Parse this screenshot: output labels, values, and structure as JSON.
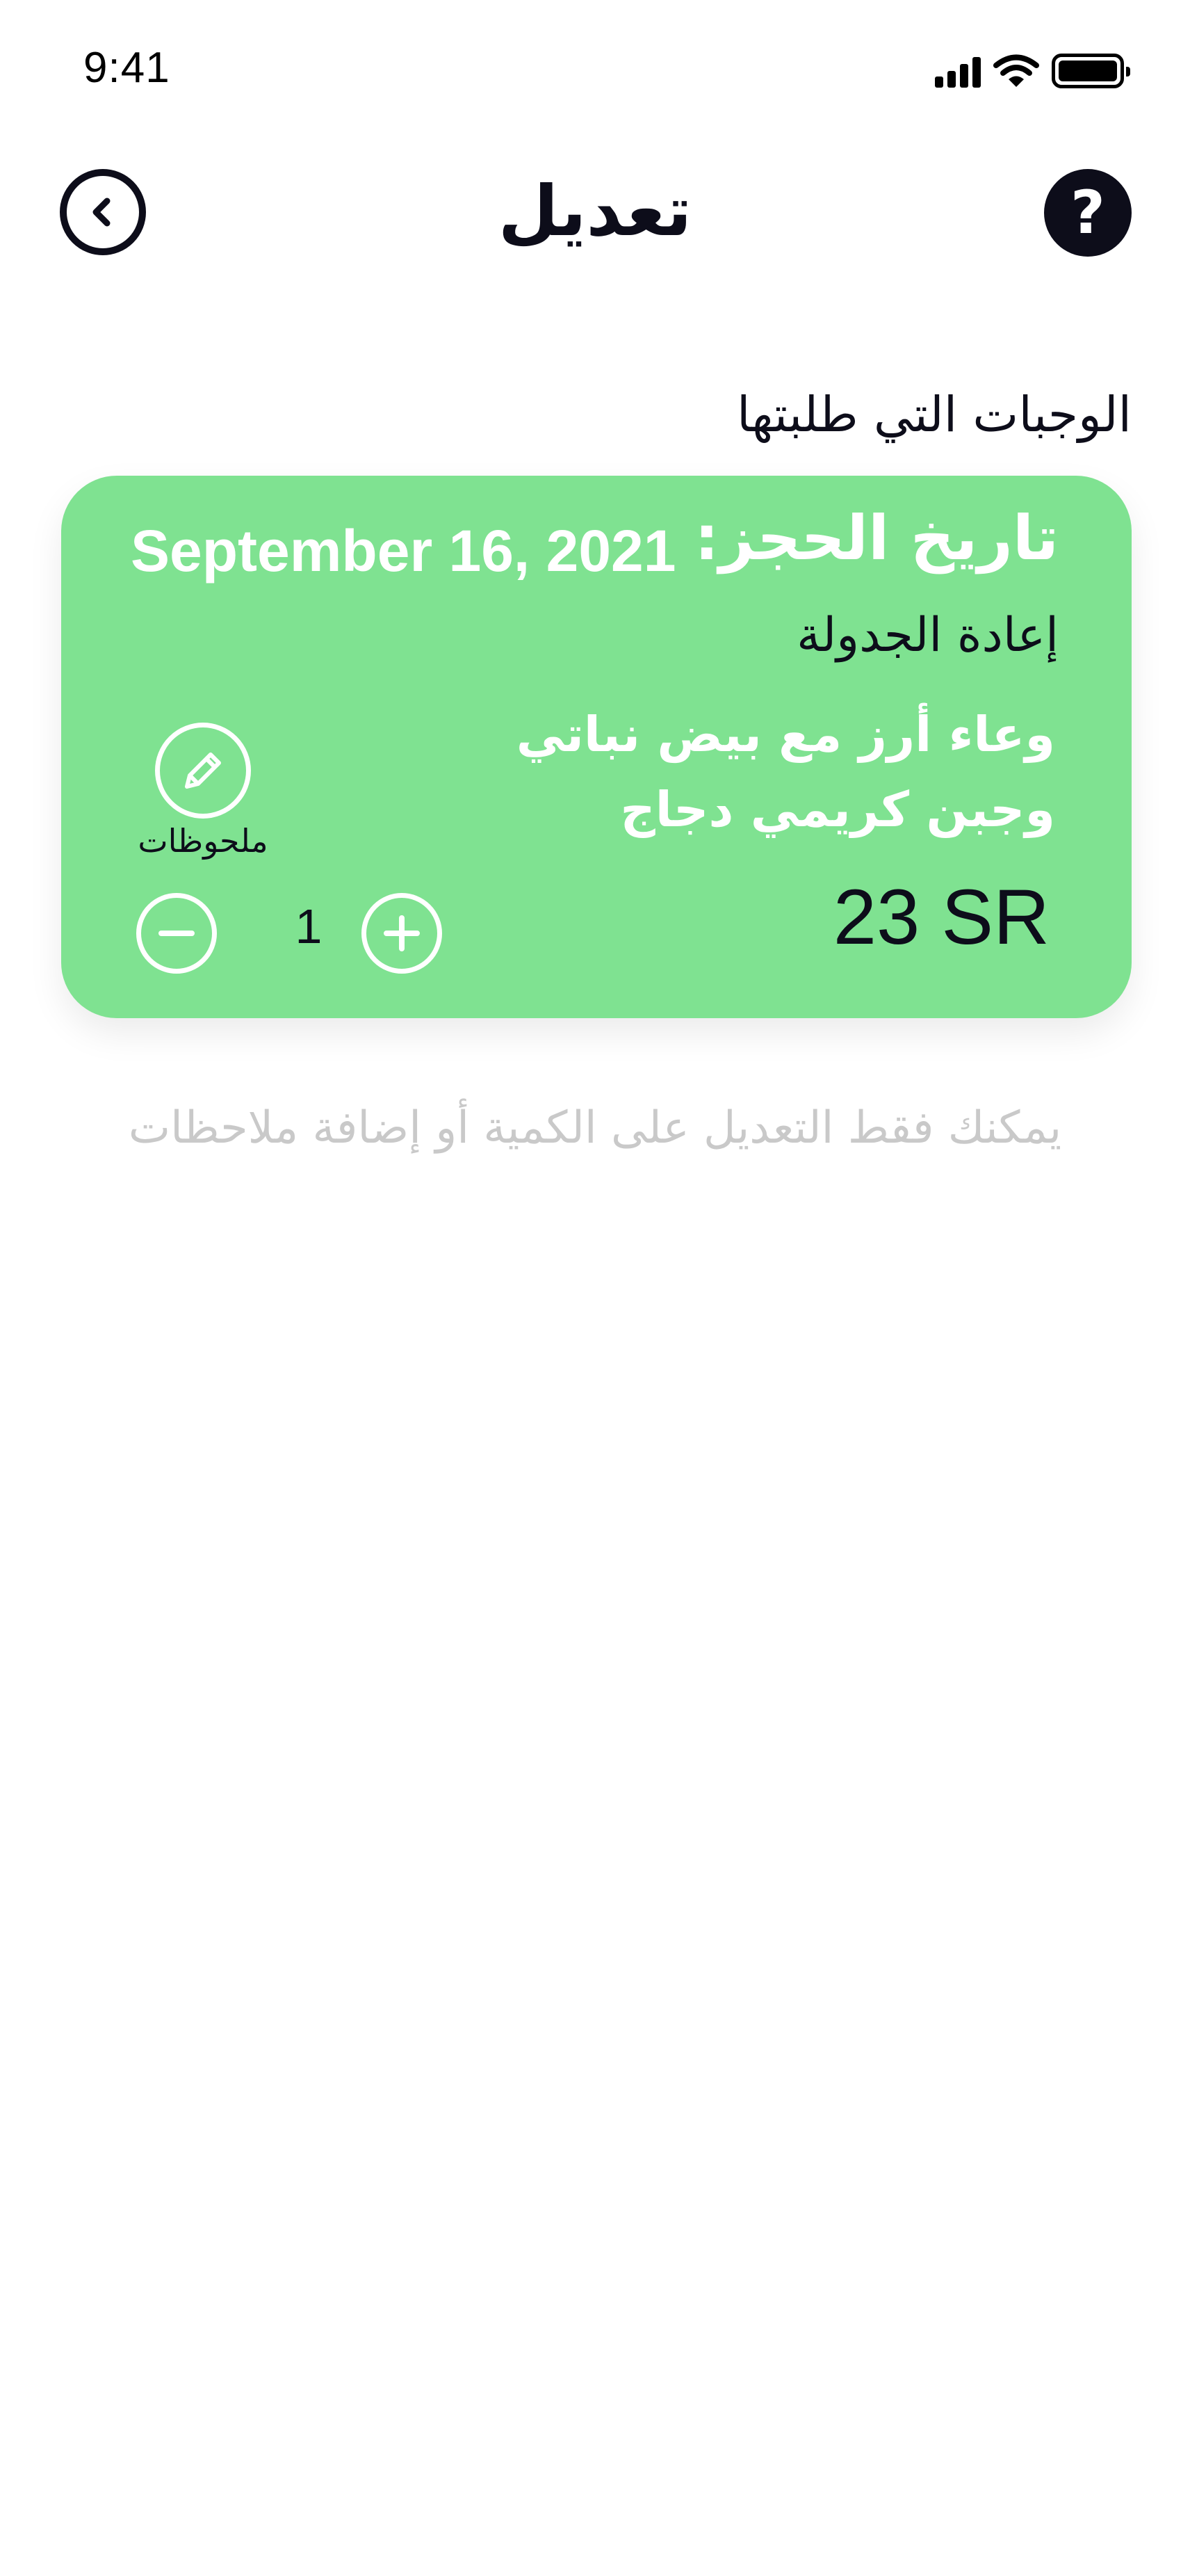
{
  "status_bar": {
    "time": "9:41",
    "icons": [
      "cellular-signal-icon",
      "wifi-icon",
      "battery-icon"
    ]
  },
  "header": {
    "title": "تعديل",
    "back_icon": "chevron-left-circle-icon",
    "help_label": "?"
  },
  "section": {
    "heading": "الوجبات التي طلبتها"
  },
  "meal_card": {
    "booking_label": "تاريخ الحجز:",
    "booking_date": "September 16, 2021",
    "reschedule_label": "إعادة الجدولة",
    "meal_name": "وعاء أرز مع بيض نباتي وجبن كريمي دجاج",
    "price": "23 SR",
    "notes_label": "ملحوظات",
    "notes_icon": "pencil-icon",
    "quantity": "1",
    "minus_icon": "minus-icon",
    "plus_icon": "plus-icon",
    "background_color": "#7fe291"
  },
  "hint": {
    "text": "يمكنك فقط التعديل على الكمية أو إضافة ملاحظات"
  },
  "colors": {
    "primary_dark": "#0d0d1a",
    "card_green": "#7fe291",
    "hint_gray": "#c9c9c9",
    "white": "#ffffff"
  }
}
